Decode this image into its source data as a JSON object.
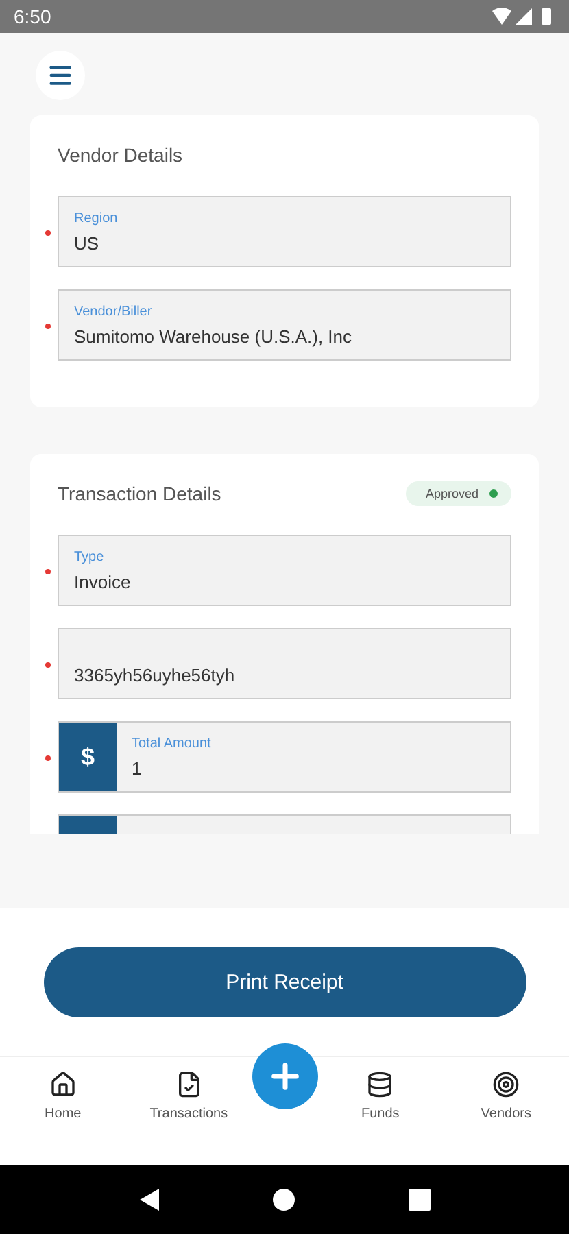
{
  "status_bar": {
    "time": "6:50"
  },
  "sections": [
    {
      "title": "Vendor Details",
      "fields": [
        {
          "kind": "text",
          "label": "Region",
          "value": "US",
          "required": true
        },
        {
          "kind": "text",
          "label": "Vendor/Biller",
          "value": "Sumitomo Warehouse (U.S.A.), Inc",
          "required": true
        }
      ]
    },
    {
      "title": "Transaction Details",
      "badge": {
        "label": "Approved",
        "color": "#2e9e4f"
      },
      "fields": [
        {
          "kind": "text",
          "label": "Type",
          "value": "Invoice",
          "required": true
        },
        {
          "kind": "text",
          "value": "3365yh56uyhe56tyh",
          "required": true
        },
        {
          "kind": "currency",
          "prefix": "$",
          "label": "Total Amount",
          "value": "1",
          "required": true
        },
        {
          "kind": "currency",
          "required": false
        }
      ]
    }
  ],
  "primary_button": "Print Receipt",
  "bottom_nav": [
    {
      "label": "Home"
    },
    {
      "label": "Transactions"
    },
    {
      "label": "Funds"
    },
    {
      "label": "Vendors"
    }
  ]
}
